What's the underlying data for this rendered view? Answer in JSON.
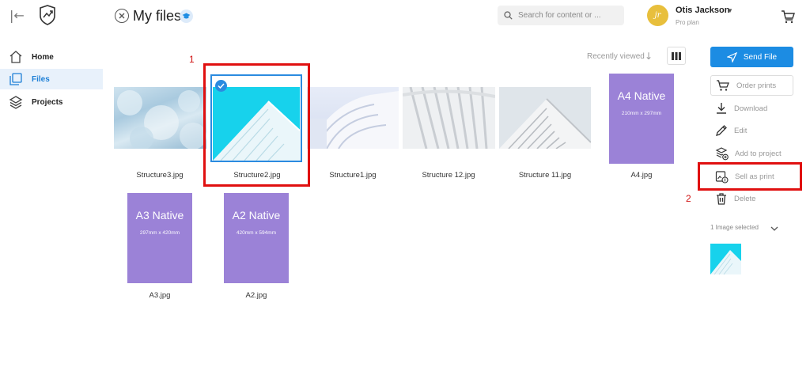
{
  "header": {
    "title": "My files",
    "search_placeholder": "Search for content or ...",
    "user": {
      "initials": "jr",
      "name": "Otis Jackson",
      "plan": "Pro plan"
    }
  },
  "sidebar": {
    "items": [
      {
        "label": "Home",
        "icon": "home-icon",
        "active": false
      },
      {
        "label": "Files",
        "icon": "files-icon",
        "active": true
      },
      {
        "label": "Projects",
        "icon": "layers-icon",
        "active": false
      }
    ]
  },
  "toolbar": {
    "sort_label": "Recently viewed"
  },
  "files": [
    {
      "name": "Structure3.jpg",
      "kind": "photo"
    },
    {
      "name": "Structure2.jpg",
      "kind": "photo",
      "selected": true
    },
    {
      "name": "Structure1.jpg",
      "kind": "photo"
    },
    {
      "name": "Structure 12.jpg",
      "kind": "photo"
    },
    {
      "name": "Structure 11.jpg",
      "kind": "photo"
    },
    {
      "name": "A4.jpg",
      "kind": "poster",
      "poster_title": "A4 Native",
      "poster_size": "210mm x 297mm"
    },
    {
      "name": "A3.jpg",
      "kind": "poster",
      "poster_title": "A3 Native",
      "poster_size": "297mm x 420mm"
    },
    {
      "name": "A2.jpg",
      "kind": "poster",
      "poster_title": "A2 Native",
      "poster_size": "420mm x 594mm"
    }
  ],
  "annotations": {
    "first": "1",
    "second": "2"
  },
  "panel": {
    "send_label": "Send File",
    "order_label": "Order prints",
    "actions": [
      {
        "label": "Download",
        "icon": "download-icon"
      },
      {
        "label": "Edit",
        "icon": "pencil-icon"
      },
      {
        "label": "Add to project",
        "icon": "add-to-project-icon"
      },
      {
        "label": "Sell as print",
        "icon": "sell-print-icon"
      },
      {
        "label": "Delete",
        "icon": "trash-icon"
      }
    ],
    "selected_count": "1 Image selected"
  },
  "colors": {
    "accent": "#1c8ce3",
    "poster": "#9b82d7",
    "annotation": "#e01010",
    "avatar": "#e8bf3c"
  }
}
